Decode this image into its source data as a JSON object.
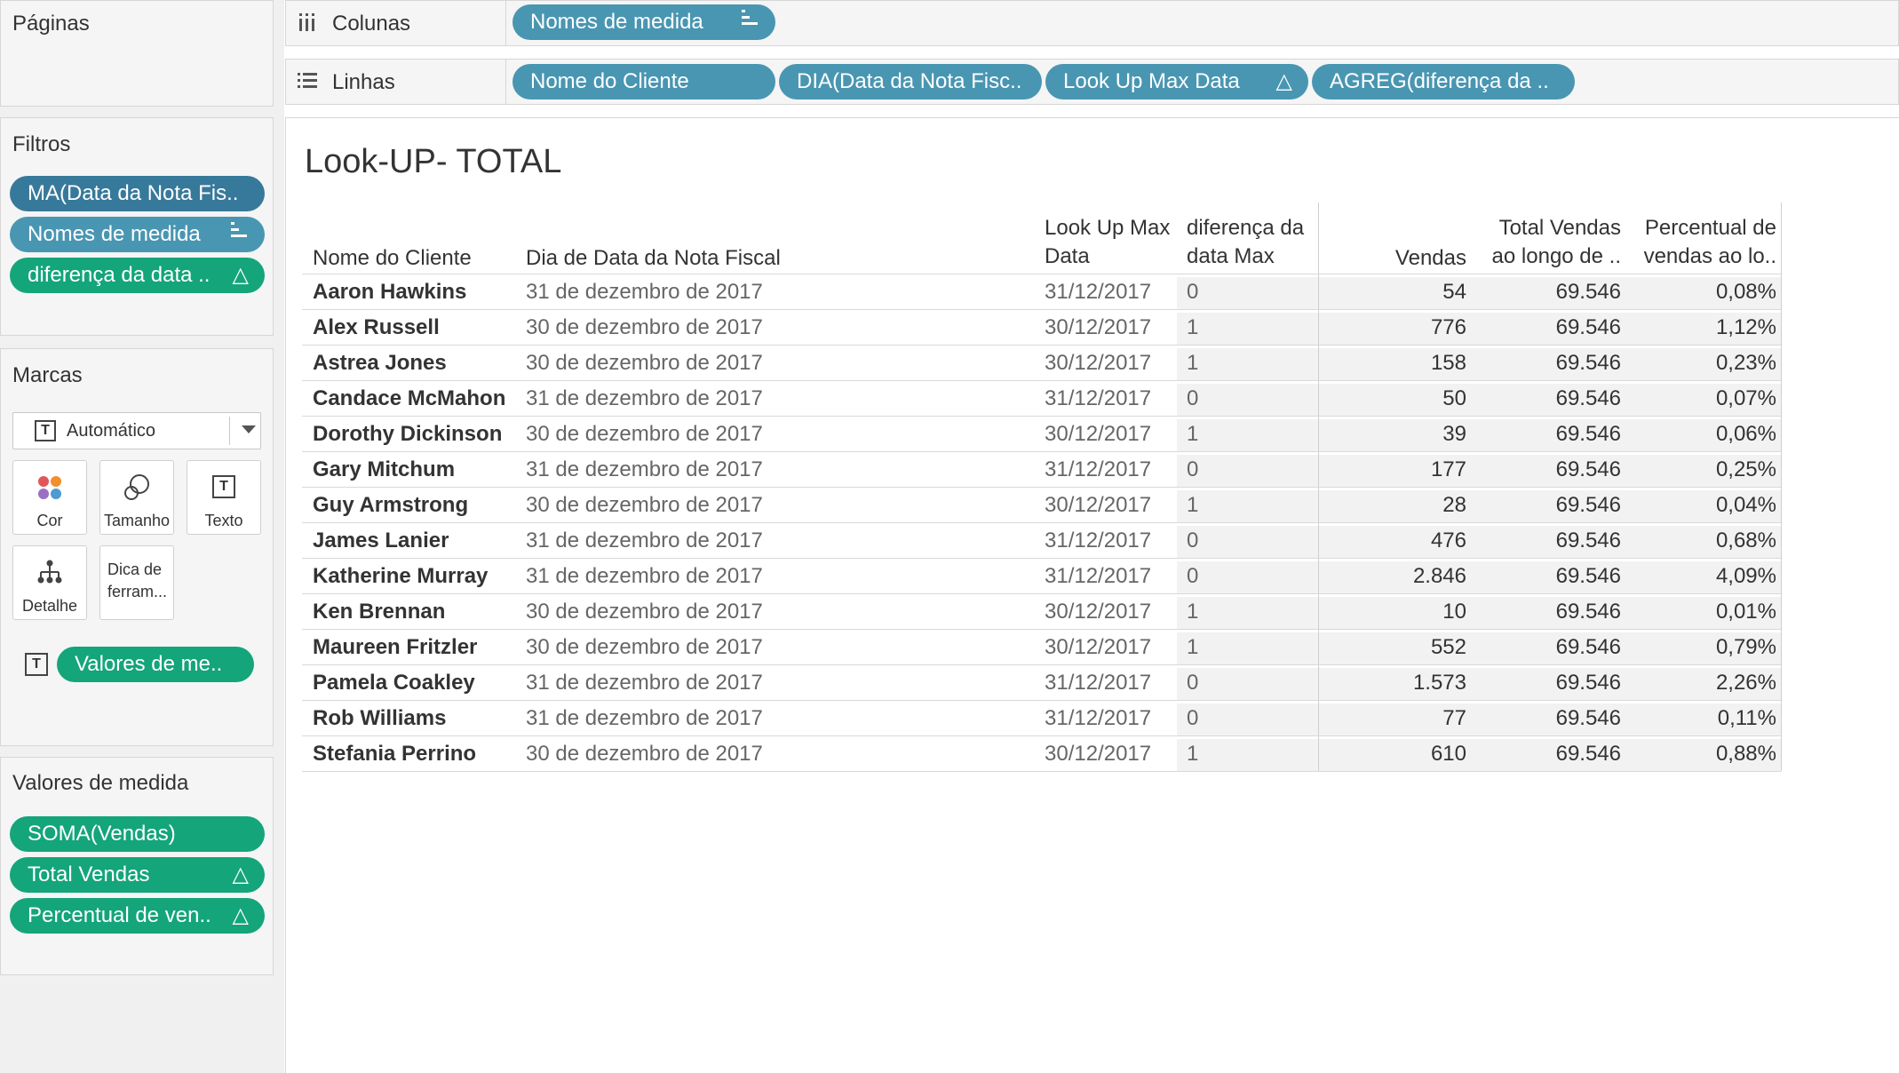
{
  "panels": {
    "pages_title": "Páginas",
    "filters_title": "Filtros",
    "filters": [
      {
        "label": "MA(Data da Nota Fis..",
        "icon": ""
      },
      {
        "label": "Nomes de medida",
        "icon": "sort-icon"
      },
      {
        "label": "diferença da data ..",
        "icon": "△"
      }
    ],
    "marks_title": "Marcas",
    "marks_type": "Automático",
    "mark_buttons": [
      "Cor",
      "Tamanho",
      "Texto",
      "Detalhe",
      "Dica de",
      "ferram..."
    ],
    "marks_pill": "Valores de me..",
    "measure_values_title": "Valores de medida",
    "measure_values": [
      {
        "label": "SOMA(Vendas)",
        "icon": ""
      },
      {
        "label": "Total Vendas",
        "icon": "△"
      },
      {
        "label": "Percentual de ven..",
        "icon": "△"
      }
    ]
  },
  "shelves": {
    "columns_label": "Colunas",
    "rows_label": "Linhas",
    "columns_pills": [
      {
        "label": "Nomes de medida",
        "icon": "sort-icon"
      }
    ],
    "rows_pills": [
      {
        "label": "Nome do Cliente",
        "icon": ""
      },
      {
        "label": "DIA(Data da Nota Fisc..",
        "icon": ""
      },
      {
        "label": "Look Up Max Data",
        "icon": "△"
      },
      {
        "label": "AGREG(diferença da ..",
        "icon": ""
      }
    ]
  },
  "sheet": {
    "title": "Look-UP- TOTAL",
    "headers": {
      "cliente": "Nome do Cliente",
      "dia": "Dia de Data da Nota Fiscal",
      "lookup_1": "Look Up Max",
      "lookup_2": "Data",
      "diff_1": "diferença da",
      "diff_2": "data Max",
      "vendas": "Vendas",
      "total_1": "Total Vendas",
      "total_2": "ao longo de ..",
      "pct_1": "Percentual de",
      "pct_2": "vendas ao lo.."
    },
    "rows": [
      {
        "cliente": "Aaron Hawkins",
        "dia": "31 de dezembro de 2017",
        "lookup": "31/12/2017",
        "diff": "0",
        "vendas": "54",
        "total": "69.546",
        "pct": "0,08%"
      },
      {
        "cliente": "Alex Russell",
        "dia": "30 de dezembro de 2017",
        "lookup": "30/12/2017",
        "diff": "1",
        "vendas": "776",
        "total": "69.546",
        "pct": "1,12%"
      },
      {
        "cliente": "Astrea Jones",
        "dia": "30 de dezembro de 2017",
        "lookup": "30/12/2017",
        "diff": "1",
        "vendas": "158",
        "total": "69.546",
        "pct": "0,23%"
      },
      {
        "cliente": "Candace McMahon",
        "dia": "31 de dezembro de 2017",
        "lookup": "31/12/2017",
        "diff": "0",
        "vendas": "50",
        "total": "69.546",
        "pct": "0,07%"
      },
      {
        "cliente": "Dorothy Dickinson",
        "dia": "30 de dezembro de 2017",
        "lookup": "30/12/2017",
        "diff": "1",
        "vendas": "39",
        "total": "69.546",
        "pct": "0,06%"
      },
      {
        "cliente": "Gary Mitchum",
        "dia": "31 de dezembro de 2017",
        "lookup": "31/12/2017",
        "diff": "0",
        "vendas": "177",
        "total": "69.546",
        "pct": "0,25%"
      },
      {
        "cliente": "Guy Armstrong",
        "dia": "30 de dezembro de 2017",
        "lookup": "30/12/2017",
        "diff": "1",
        "vendas": "28",
        "total": "69.546",
        "pct": "0,04%"
      },
      {
        "cliente": "James Lanier",
        "dia": "31 de dezembro de 2017",
        "lookup": "31/12/2017",
        "diff": "0",
        "vendas": "476",
        "total": "69.546",
        "pct": "0,68%"
      },
      {
        "cliente": "Katherine Murray",
        "dia": "31 de dezembro de 2017",
        "lookup": "31/12/2017",
        "diff": "0",
        "vendas": "2.846",
        "total": "69.546",
        "pct": "4,09%"
      },
      {
        "cliente": "Ken Brennan",
        "dia": "30 de dezembro de 2017",
        "lookup": "30/12/2017",
        "diff": "1",
        "vendas": "10",
        "total": "69.546",
        "pct": "0,01%"
      },
      {
        "cliente": "Maureen Fritzler",
        "dia": "30 de dezembro de 2017",
        "lookup": "30/12/2017",
        "diff": "1",
        "vendas": "552",
        "total": "69.546",
        "pct": "0,79%"
      },
      {
        "cliente": "Pamela Coakley",
        "dia": "31 de dezembro de 2017",
        "lookup": "31/12/2017",
        "diff": "0",
        "vendas": "1.573",
        "total": "69.546",
        "pct": "2,26%"
      },
      {
        "cliente": "Rob Williams",
        "dia": "31 de dezembro de 2017",
        "lookup": "31/12/2017",
        "diff": "0",
        "vendas": "77",
        "total": "69.546",
        "pct": "0,11%"
      },
      {
        "cliente": "Stefania Perrino",
        "dia": "30 de dezembro de 2017",
        "lookup": "30/12/2017",
        "diff": "1",
        "vendas": "610",
        "total": "69.546",
        "pct": "0,88%"
      }
    ]
  },
  "colors": {
    "pill_dark": "#37799a",
    "pill_blue": "#4996b2",
    "pill_green": "#14a57a"
  }
}
